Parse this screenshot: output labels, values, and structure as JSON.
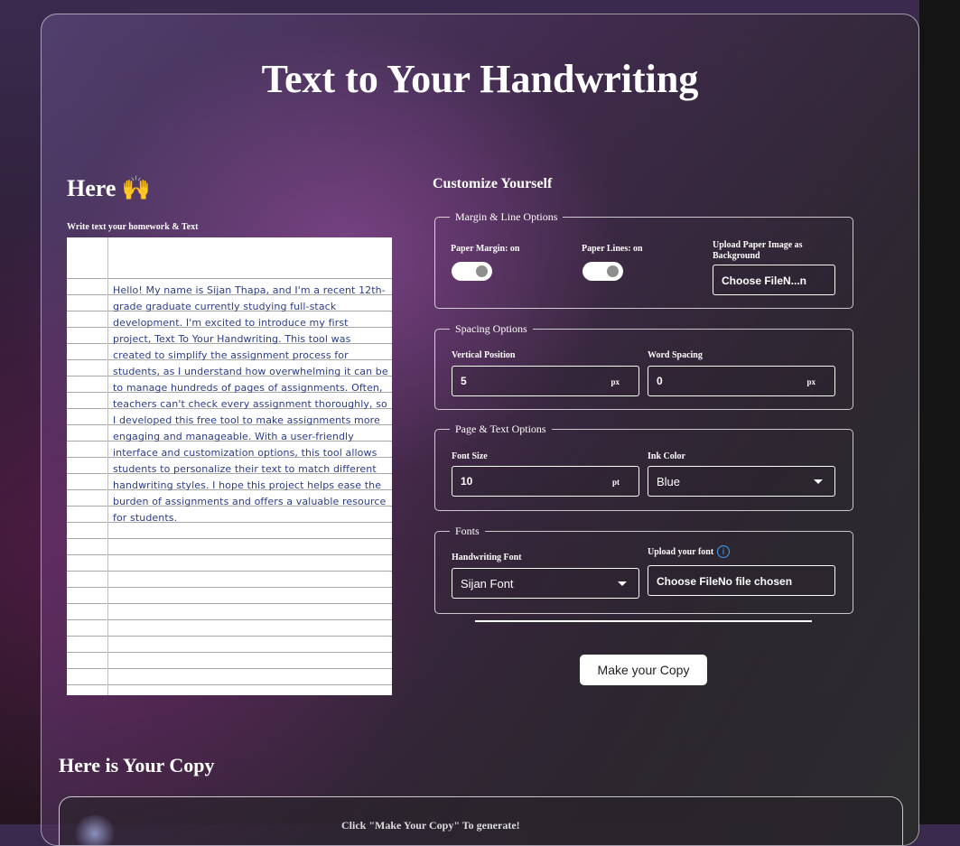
{
  "title": "Text to Your Handwriting",
  "input_section": {
    "heading": "Here 🙌",
    "write_label": "Write text your homework & Text",
    "paper_text": "Hello! My name is Sijan Thapa, and I'm a recent 12th-grade graduate currently studying full-stack development. I'm excited to introduce my first project, Text To Your Handwriting. This tool was created to simplify the assignment process for students, as I understand how overwhelming it can be to manage hundreds of pages of assignments. Often, teachers can't check every assignment thoroughly, so I developed this free tool to make assignments more engaging and manageable. With a user-friendly interface and customization options, this tool allows students to personalize their text to match different handwriting styles. I hope this project helps ease the burden of assignments and offers a valuable resource for students."
  },
  "customize": {
    "heading": "Customize Yourself",
    "margin_line": {
      "legend": "Margin & Line Options",
      "paper_margin_label": "Paper Margin: on",
      "paper_margin_on": true,
      "paper_lines_label": "Paper Lines: on",
      "paper_lines_on": true,
      "upload_label": "Upload Paper Image as Background",
      "upload_button": "Choose FileN...n"
    },
    "spacing": {
      "legend": "Spacing Options",
      "vertical_label": "Vertical Position",
      "vertical_value": "5",
      "vertical_unit": "px",
      "word_label": "Word Spacing",
      "word_value": "0",
      "word_unit": "px"
    },
    "page_text": {
      "legend": "Page & Text Options",
      "font_size_label": "Font Size",
      "font_size_value": "10",
      "font_size_unit": "pt",
      "ink_label": "Ink Color",
      "ink_value": "Blue"
    },
    "fonts": {
      "legend": "Fonts",
      "handwriting_label": "Handwriting Font",
      "handwriting_value": "Sijan Font",
      "upload_font_label": "Upload your font",
      "upload_font_button": "Choose FileNo file chosen",
      "info_glyph": "i"
    }
  },
  "make_copy_button": "Make your Copy",
  "output_section": {
    "heading": "Here is Your Copy",
    "hint": "Click \"Make Your Copy\" To generate!"
  },
  "colors": {
    "paper_ink": "#2b3d8a",
    "margin_line": "#f2a6b0",
    "info_icon": "#3da0ff"
  }
}
